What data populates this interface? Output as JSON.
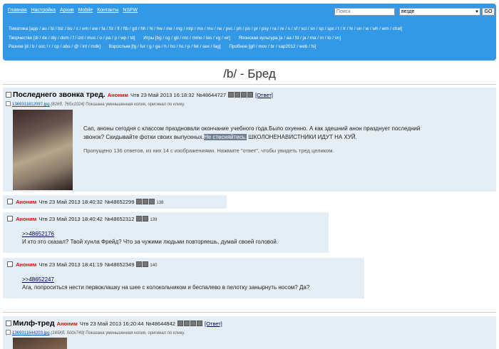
{
  "nav": {
    "links": [
      "Главная",
      "Настройка",
      "Архив",
      "Mobile",
      "Контакты",
      "NSFW"
    ],
    "search_placeholder": "Поиск",
    "select_value": "везде",
    "go_label": "GO"
  },
  "categories": {
    "line1": "Тематика [app / au / bi / biz / bo / c / em / ew / fa / fiz / fl / ftb / gd / hh / hi / hw / me / mg / mlp / mo / mu / ne / pvc / ph / po / pr / psy / ra / re / s / sf / sci / sn / sp / spc / t / tr / tv / un / w / wh / wm / chat]",
    "line2a": "Творчество [di / de / diy / dom / f / izd / mus / o / pa / p / wp / td]",
    "line2b": "Игры [bg / cg / gb / mc / mmo / tes / vg / wr]",
    "line2c": "Японская культура [a / aa / fd / ja / ma / m / to / vn]",
    "line3a": "Разное [d / b / soc / r / cp / abu / @ / int / mdk]",
    "line3b": "Взрослым [fg / fur / g / ga / h / ho / hc / p / fet / sex / fag]",
    "line3c": "Пробное [gif / mov / br / sap2012 / web / fs]"
  },
  "board": {
    "title": "/b/ - Бред"
  },
  "thread1": {
    "subject": "Последнего звонка тред.",
    "name": "Аноним",
    "datetime": "Чтв 23 Май 2013 16:18:32",
    "number": "№48644727",
    "reply_label": "[Ответ]",
    "file_name": "1369311812097.jpg",
    "file_info": "(82Кб, 765x1024)",
    "file_note": "Показана уменьшенная копия, оригинал по клику.",
    "text_line1": "Сап, аноны сегодня с классом праздновали окончание учебного года.Было охуенно. А как здешний анон празднует последний",
    "text_line2a": "звонок? Скидывайте фотки своих выпускных.",
    "text_line2b": "Не стесняйтесь.",
    "text_line2c": " ШКОЛОНЕНАВИСТНИКИ ИДУТ НА ХУЙ.",
    "omitted": "Пропущено 136 ответов, из них 14 с изображениями. Нажмите \"ответ\", чтобы увидеть тред целиком."
  },
  "replies": [
    {
      "name": "Аноним",
      "datetime": "Чтв 23 Май 2013 18:40:32",
      "number": "№48652299",
      "index": "138",
      "quote": "",
      "text": ""
    },
    {
      "name": "Аноним",
      "datetime": "Чтв 23 Май 2013 18:40:42",
      "number": "№48652312",
      "index": "139",
      "quote": ">>48652176",
      "text": "И кто это сказал? Твой хунла Фрейд? Что за чужими людьми повторяешь, думай своей головой."
    },
    {
      "name": "Аноним",
      "datetime": "Чтв 23 Май 2013 18:41:19",
      "number": "№48652349",
      "index": "140",
      "quote": ">>48652247",
      "text": "Ага, попроситься нести первоклашку на шее с колокольчиком и беспалево в пелотку занырнуть носом? Да?"
    }
  ],
  "thread2": {
    "subject": "Милф-тред",
    "name": "Аноним",
    "datetime": "Чтв 23 Май 2013 16:20:44",
    "number": "№48644842",
    "reply_label": "[Ответ]",
    "file_name": "1369311644203.jpg",
    "file_info": "(165Кб, 500x749)",
    "file_note": "Показана уменьшенная копия, оригинал по клику."
  }
}
